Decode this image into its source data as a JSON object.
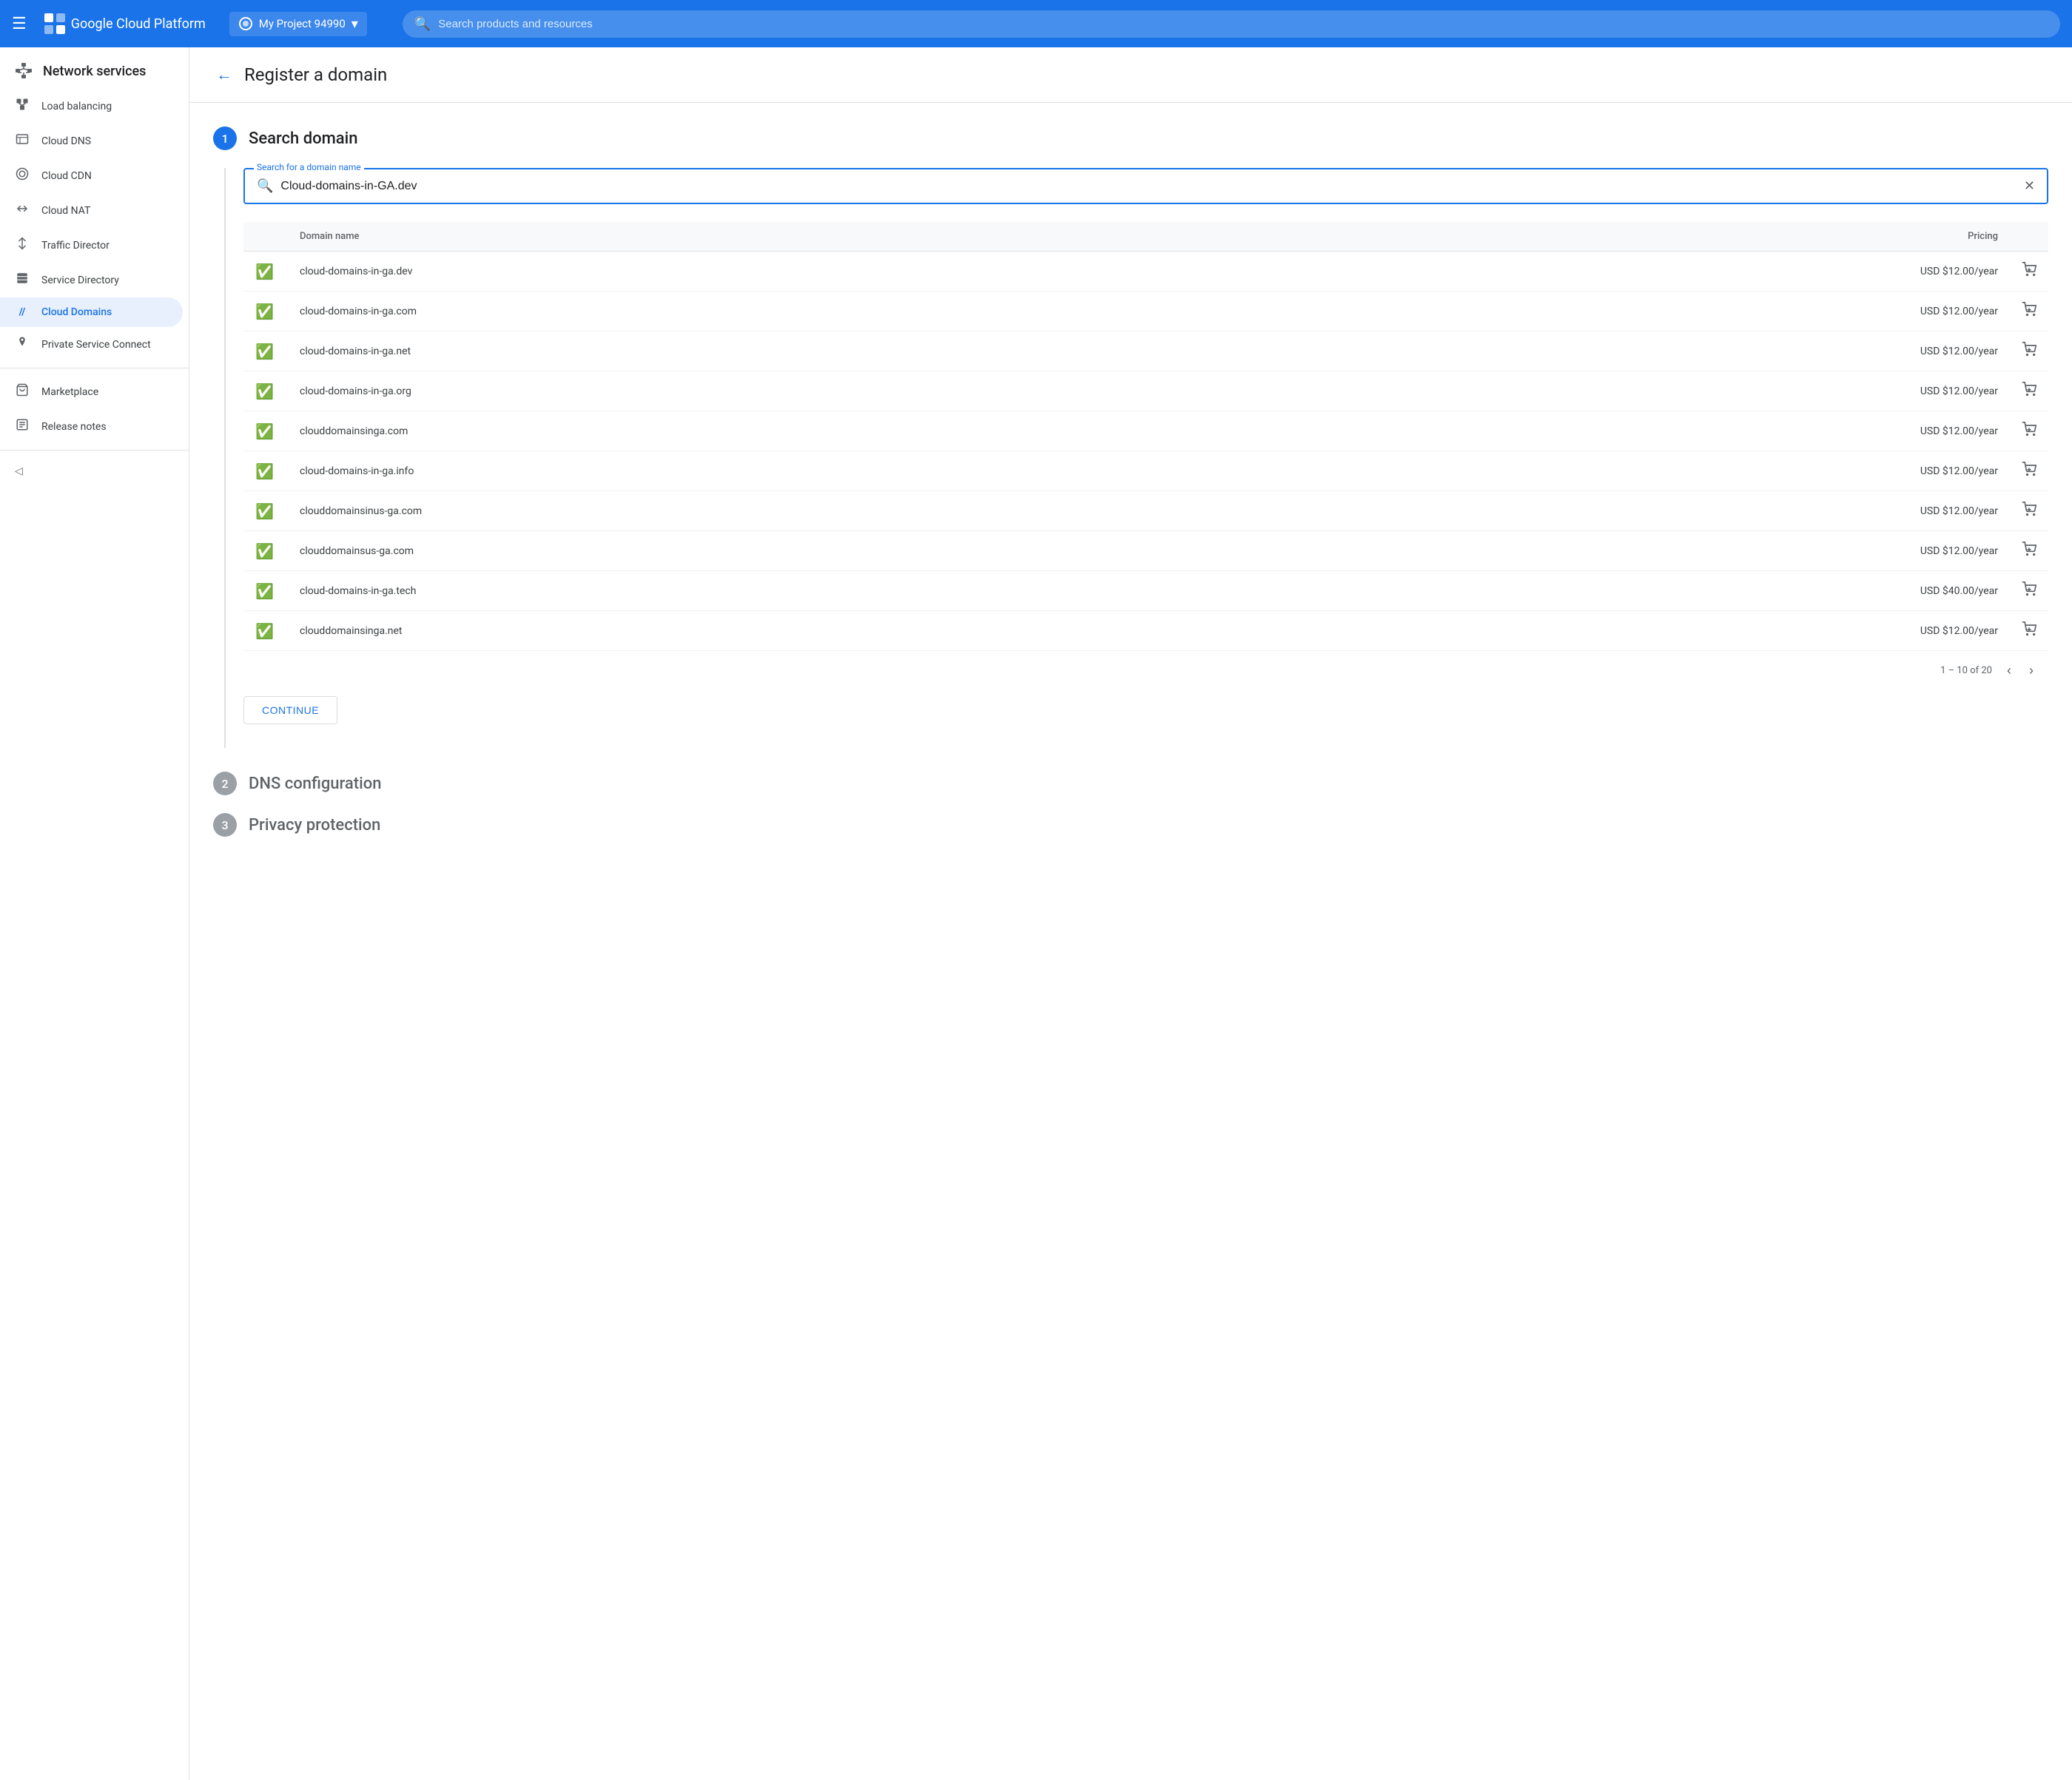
{
  "header": {
    "menu_icon": "☰",
    "brand_name": "Google Cloud Platform",
    "project_name": "My Project 94990",
    "search_placeholder": "Search products and resources"
  },
  "sidebar": {
    "title": "Network services",
    "items": [
      {
        "id": "load-balancing",
        "label": "Load balancing",
        "icon": "⊟",
        "active": false
      },
      {
        "id": "cloud-dns",
        "label": "Cloud DNS",
        "icon": "▦",
        "active": false
      },
      {
        "id": "cloud-cdn",
        "label": "Cloud CDN",
        "icon": "◎",
        "active": false
      },
      {
        "id": "cloud-nat",
        "label": "Cloud NAT",
        "icon": "⇄",
        "active": false
      },
      {
        "id": "traffic-director",
        "label": "Traffic Director",
        "icon": "↕",
        "active": false
      },
      {
        "id": "service-directory",
        "label": "Service Directory",
        "icon": "▤",
        "active": false
      },
      {
        "id": "cloud-domains",
        "label": "Cloud Domains",
        "icon": "//",
        "active": true
      },
      {
        "id": "private-service-connect",
        "label": "Private Service Connect",
        "icon": "🔒",
        "active": false
      }
    ],
    "bottom_items": [
      {
        "id": "marketplace",
        "label": "Marketplace",
        "icon": "🛒"
      },
      {
        "id": "release-notes",
        "label": "Release notes",
        "icon": "📋"
      }
    ],
    "collapse_label": "◁"
  },
  "page": {
    "back_button": "←",
    "title": "Register a domain"
  },
  "steps": {
    "step1": {
      "number": "1",
      "title": "Search domain",
      "search_label": "Search for a domain name",
      "search_value": "Cloud-domains-in-GA.dev",
      "table": {
        "col1": "Domain name",
        "col2": "Pricing",
        "rows": [
          {
            "domain": "cloud-domains-in-ga.dev",
            "price": "USD $12.00/year",
            "available": true
          },
          {
            "domain": "cloud-domains-in-ga.com",
            "price": "USD $12.00/year",
            "available": true
          },
          {
            "domain": "cloud-domains-in-ga.net",
            "price": "USD $12.00/year",
            "available": true
          },
          {
            "domain": "cloud-domains-in-ga.org",
            "price": "USD $12.00/year",
            "available": true
          },
          {
            "domain": "clouddomainsinga.com",
            "price": "USD $12.00/year",
            "available": true
          },
          {
            "domain": "cloud-domains-in-ga.info",
            "price": "USD $12.00/year",
            "available": true
          },
          {
            "domain": "clouddomainsinus-ga.com",
            "price": "USD $12.00/year",
            "available": true
          },
          {
            "domain": "clouddomainsus-ga.com",
            "price": "USD $12.00/year",
            "available": true
          },
          {
            "domain": "cloud-domains-in-ga.tech",
            "price": "USD $40.00/year",
            "available": true
          },
          {
            "domain": "clouddomainsinga.net",
            "price": "USD $12.00/year",
            "available": true
          }
        ],
        "pagination": "1 – 10 of 20"
      },
      "continue_button": "CONTINUE"
    },
    "step2": {
      "number": "2",
      "title": "DNS configuration"
    },
    "step3": {
      "number": "3",
      "title": "Privacy protection"
    }
  }
}
